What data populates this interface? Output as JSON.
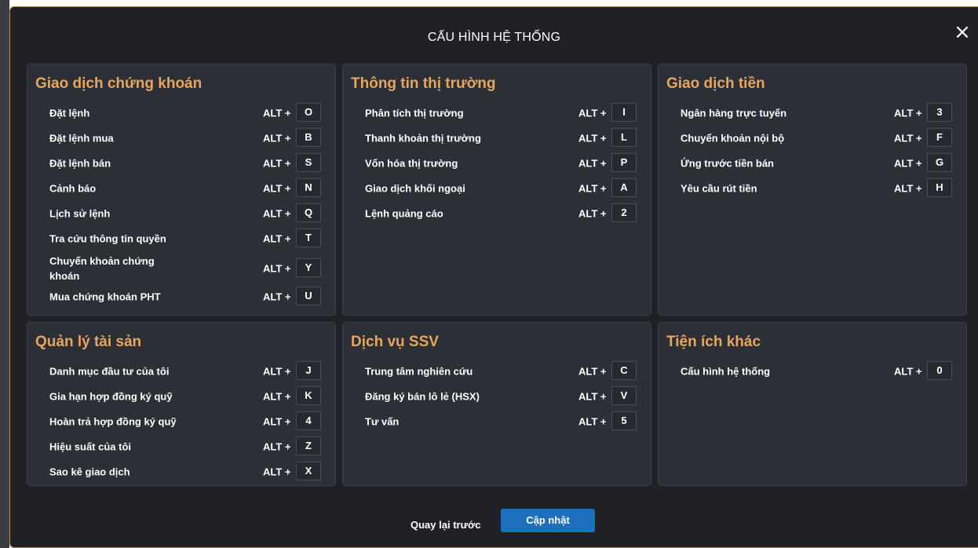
{
  "dialog": {
    "title": "CẤU HÌNH HỆ THỐNG",
    "close_icon": "×",
    "back_label": "Quay lại trước",
    "update_label": "Cập nhật",
    "colors": {
      "accent": "#e8a55c",
      "primary_button": "#1e6fbd",
      "background": "#1f2126",
      "panel": "#2c2f35"
    }
  },
  "sections": [
    {
      "title": "Giao dịch chứng khoán",
      "items": [
        {
          "label": "Đặt lệnh",
          "alt": "ALT +",
          "key": "O"
        },
        {
          "label": "Đặt lệnh mua",
          "alt": "ALT +",
          "key": "B"
        },
        {
          "label": "Đặt lệnh bán",
          "alt": "ALT +",
          "key": "S"
        },
        {
          "label": "Cảnh báo",
          "alt": "ALT +",
          "key": "N"
        },
        {
          "label": "Lịch sử lệnh",
          "alt": "ALT +",
          "key": "Q"
        },
        {
          "label": "Tra cứu thông tin quyền",
          "alt": "ALT +",
          "key": "T"
        },
        {
          "label": "Chuyển khoản chứng khoán",
          "alt": "ALT +",
          "key": "Y"
        },
        {
          "label": "Mua chứng khoán PHT",
          "alt": "ALT +",
          "key": "U"
        }
      ]
    },
    {
      "title": "Thông tin thị trường",
      "items": [
        {
          "label": "Phân tích thị trường",
          "alt": "ALT +",
          "key": "I"
        },
        {
          "label": "Thanh khoản thị trường",
          "alt": "ALT +",
          "key": "L"
        },
        {
          "label": "Vốn hóa thị trường",
          "alt": "ALT +",
          "key": "P"
        },
        {
          "label": "Giao dịch khối ngoại",
          "alt": "ALT +",
          "key": "A"
        },
        {
          "label": "Lệnh quảng cáo",
          "alt": "ALT +",
          "key": "2"
        }
      ]
    },
    {
      "title": "Giao dịch tiền",
      "items": [
        {
          "label": "Ngân hàng trực tuyến",
          "alt": "ALT +",
          "key": "3"
        },
        {
          "label": "Chuyển khoản nội bộ",
          "alt": "ALT +",
          "key": "F"
        },
        {
          "label": "Ứng trước tiền bán",
          "alt": "ALT +",
          "key": "G"
        },
        {
          "label": "Yêu cầu rút tiền",
          "alt": "ALT +",
          "key": "H"
        }
      ]
    },
    {
      "title": "Quản lý tài sản",
      "items": [
        {
          "label": "Danh mục đầu tư của tôi",
          "alt": "ALT +",
          "key": "J"
        },
        {
          "label": "Gia hạn hợp đồng ký quỹ",
          "alt": "ALT +",
          "key": "K"
        },
        {
          "label": "Hoàn trả hợp đồng ký quỹ",
          "alt": "ALT +",
          "key": "4"
        },
        {
          "label": "Hiệu suất của tôi",
          "alt": "ALT +",
          "key": "Z"
        },
        {
          "label": "Sao kê giao dịch",
          "alt": "ALT +",
          "key": "X"
        }
      ]
    },
    {
      "title": "Dịch vụ SSV",
      "items": [
        {
          "label": "Trung tâm nghiên cứu",
          "alt": "ALT +",
          "key": "C"
        },
        {
          "label": "Đăng ký bán lô lẻ (HSX)",
          "alt": "ALT +",
          "key": "V"
        },
        {
          "label": "Tư vấn",
          "alt": "ALT +",
          "key": "5"
        }
      ]
    },
    {
      "title": "Tiện ích khác",
      "items": [
        {
          "label": "Cấu hình hệ thống",
          "alt": "ALT +",
          "key": "0"
        }
      ]
    }
  ]
}
